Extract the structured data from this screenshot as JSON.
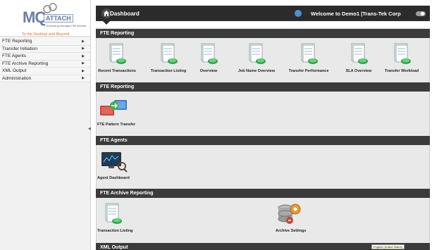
{
  "logo": {
    "brand_mq": "MQ",
    "brand_attach": "ATTACH",
    "subtitle": "Extending managed file transfer",
    "tagline": "To the Desktop and Beyond"
  },
  "sidebar": {
    "items": [
      {
        "label": "FTE Reporting"
      },
      {
        "label": "Transfer Initiation"
      },
      {
        "label": "FTE Agents"
      },
      {
        "label": "FTE Archive Reporting"
      },
      {
        "label": "XML Output"
      },
      {
        "label": "Administration"
      }
    ],
    "arrow": "▶",
    "collapse_glyph": "◀"
  },
  "header": {
    "title": "Dashboard",
    "welcome": "Welcome to  Demo1 |Trans-Tek Corp"
  },
  "sections": {
    "fte_reporting_1": "FTE Reporting",
    "fte_reporting_2": "FTE Reporting",
    "fte_agents": "FTE Agents",
    "fte_archive": "FTE Archive Reporting",
    "xml_output": "XML Output"
  },
  "tiles": {
    "recent_transactions": "Recent Transactions",
    "transaction_listing": "Transaction Listing",
    "overview": "Overview",
    "job_name_overview": "Job Name Overview",
    "transfer_performance": "Transfer Performance",
    "sla_overview": "SLA Overview",
    "transfer_workload": "Transfer Workload",
    "fte_pattern_transfer": "FTE Pattern Transfer",
    "agent_dashboard": "Agent Dashboard",
    "archive_transaction_listing": "Transaction Listing",
    "archive_settings": "Archive Settings"
  },
  "status": {
    "language": "English (United States)"
  },
  "colors": {
    "topbar": "#2b2b2b",
    "section_bar": "#3b3b3b",
    "content_bg": "#e9e9e9",
    "tagline": "#d9761f",
    "brand": "#6a7fa3"
  }
}
